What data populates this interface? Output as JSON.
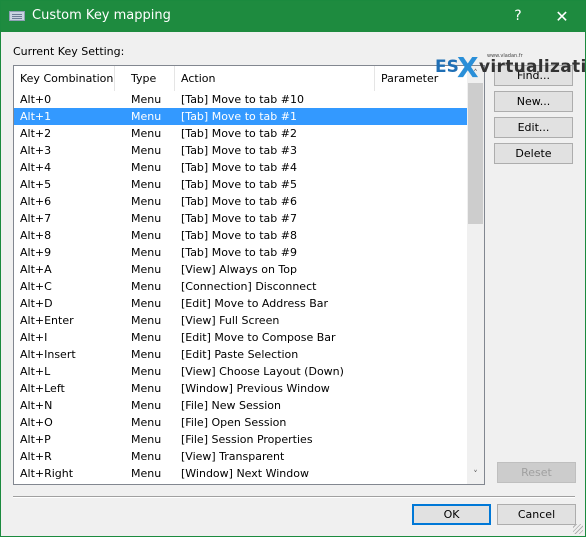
{
  "window": {
    "title": "Custom Key mapping",
    "help_label": "?",
    "close_label": "✕",
    "icon": "keyboard-icon"
  },
  "label_current": "Current Key Setting:",
  "list": {
    "columns": [
      "Key Combination",
      "Type",
      "Action",
      "Parameter"
    ],
    "selected_index": 1,
    "rows": [
      {
        "key": "Alt+0",
        "type": "Menu",
        "action": "[Tab] Move to tab #10",
        "param": ""
      },
      {
        "key": "Alt+1",
        "type": "Menu",
        "action": "[Tab] Move to tab #1",
        "param": ""
      },
      {
        "key": "Alt+2",
        "type": "Menu",
        "action": "[Tab] Move to tab #2",
        "param": ""
      },
      {
        "key": "Alt+3",
        "type": "Menu",
        "action": "[Tab] Move to tab #3",
        "param": ""
      },
      {
        "key": "Alt+4",
        "type": "Menu",
        "action": "[Tab] Move to tab #4",
        "param": ""
      },
      {
        "key": "Alt+5",
        "type": "Menu",
        "action": "[Tab] Move to tab #5",
        "param": ""
      },
      {
        "key": "Alt+6",
        "type": "Menu",
        "action": "[Tab] Move to tab #6",
        "param": ""
      },
      {
        "key": "Alt+7",
        "type": "Menu",
        "action": "[Tab] Move to tab #7",
        "param": ""
      },
      {
        "key": "Alt+8",
        "type": "Menu",
        "action": "[Tab] Move to tab #8",
        "param": ""
      },
      {
        "key": "Alt+9",
        "type": "Menu",
        "action": "[Tab] Move to tab #9",
        "param": ""
      },
      {
        "key": "Alt+A",
        "type": "Menu",
        "action": "[View] Always on Top",
        "param": ""
      },
      {
        "key": "Alt+C",
        "type": "Menu",
        "action": "[Connection] Disconnect",
        "param": ""
      },
      {
        "key": "Alt+D",
        "type": "Menu",
        "action": "[Edit] Move to Address Bar",
        "param": ""
      },
      {
        "key": "Alt+Enter",
        "type": "Menu",
        "action": "[View] Full Screen",
        "param": ""
      },
      {
        "key": "Alt+I",
        "type": "Menu",
        "action": "[Edit] Move to Compose Bar",
        "param": ""
      },
      {
        "key": "Alt+Insert",
        "type": "Menu",
        "action": "[Edit] Paste Selection",
        "param": ""
      },
      {
        "key": "Alt+L",
        "type": "Menu",
        "action": "[View] Choose Layout (Down)",
        "param": ""
      },
      {
        "key": "Alt+Left",
        "type": "Menu",
        "action": "[Window] Previous Window",
        "param": ""
      },
      {
        "key": "Alt+N",
        "type": "Menu",
        "action": "[File] New Session",
        "param": ""
      },
      {
        "key": "Alt+O",
        "type": "Menu",
        "action": "[File] Open Session",
        "param": ""
      },
      {
        "key": "Alt+P",
        "type": "Menu",
        "action": "[File] Session Properties",
        "param": ""
      },
      {
        "key": "Alt+R",
        "type": "Menu",
        "action": "[View] Transparent",
        "param": ""
      },
      {
        "key": "Alt+Right",
        "type": "Menu",
        "action": "[Window] Next Window",
        "param": ""
      }
    ]
  },
  "buttons": {
    "find": "Find...",
    "new": "New...",
    "edit": "Edit...",
    "delete": "Delete",
    "reset": "Reset",
    "ok": "OK",
    "cancel": "Cancel"
  },
  "watermark": {
    "es": "ES",
    "x": "X",
    "virtualization": "virtualization",
    "url": "www.vladan.fr"
  },
  "colors": {
    "titlebar": "#1e8b3f",
    "selection": "#3399ff",
    "default_button_border": "#0078d7"
  }
}
